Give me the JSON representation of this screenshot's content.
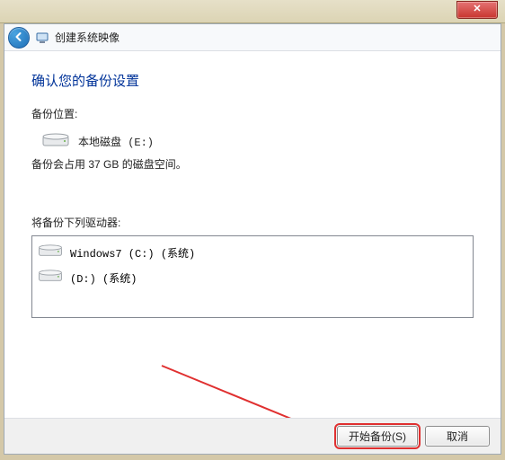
{
  "titlebar": {
    "close": "✕"
  },
  "nav": {
    "title": "创建系统映像"
  },
  "main": {
    "heading": "确认您的备份设置",
    "locationLabel": "备份位置:",
    "locationDrive": "本地磁盘 (E:)",
    "sizeText": "备份会占用 37 GB 的磁盘空间。",
    "listLabel": "将备份下列驱动器:",
    "drives": [
      {
        "label": "Windows7 (C:) (系统)"
      },
      {
        "label": "(D:) (系统)"
      }
    ]
  },
  "footer": {
    "start": "开始备份(S)",
    "cancel": "取消"
  }
}
